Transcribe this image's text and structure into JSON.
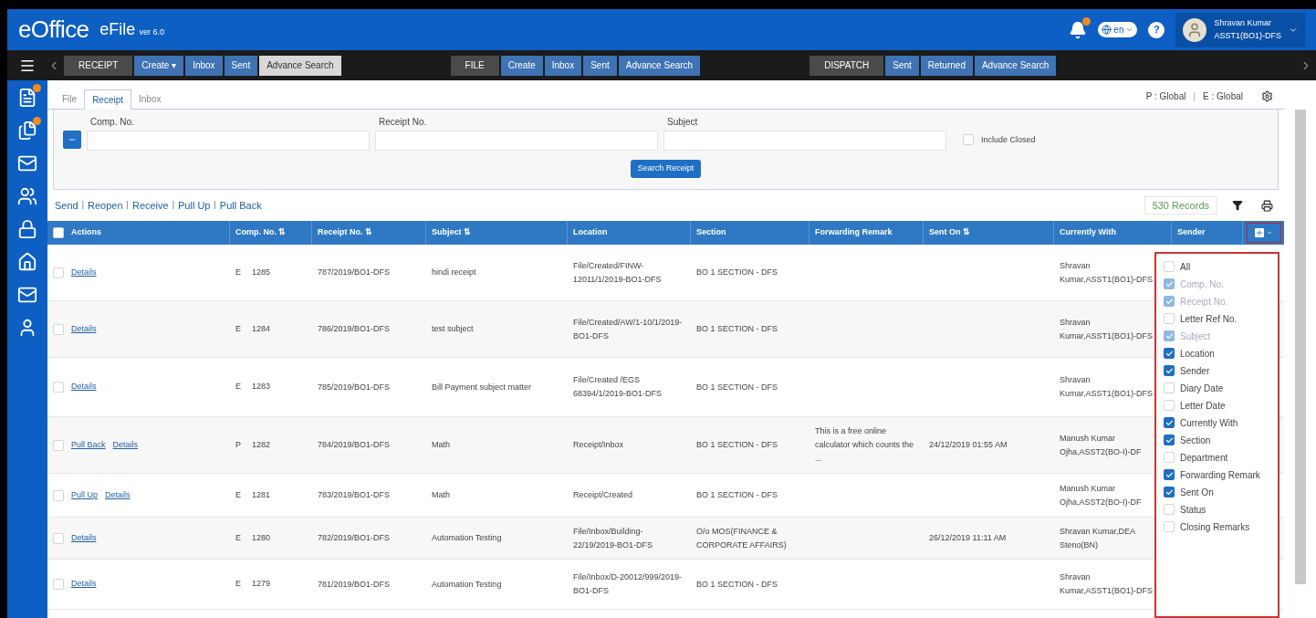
{
  "header": {
    "logo": "eOffice",
    "app": "eFile",
    "version": "ver 6.0",
    "language": "en",
    "help": "?",
    "user_name": "Shravan Kumar",
    "user_role": "ASST1(BO1)-DFS"
  },
  "nav": {
    "groups": [
      {
        "label": "RECEIPT",
        "items": [
          {
            "label": "Create ▾",
            "selected": false
          },
          {
            "label": "Inbox",
            "selected": false
          },
          {
            "label": "Sent",
            "selected": false
          },
          {
            "label": "Advance Search",
            "selected": true
          }
        ]
      },
      {
        "label": "FILE",
        "items": [
          {
            "label": "Create",
            "selected": false
          },
          {
            "label": "Inbox",
            "selected": false
          },
          {
            "label": "Sent",
            "selected": false
          },
          {
            "label": "Advance Search",
            "selected": false
          }
        ]
      },
      {
        "label": "DISPATCH",
        "items": [
          {
            "label": "Sent",
            "selected": false
          },
          {
            "label": "Returned",
            "selected": false
          },
          {
            "label": "Advance Search",
            "selected": false
          }
        ]
      }
    ]
  },
  "tabs": [
    {
      "label": "File",
      "selected": false
    },
    {
      "label": "Receipt",
      "selected": true
    },
    {
      "label": "Inbox",
      "selected": false
    }
  ],
  "scope": {
    "p": "P : Global",
    "separator": "|",
    "e": "E : Global"
  },
  "search": {
    "fields": [
      {
        "label": "Comp. No."
      },
      {
        "label": "Receipt No."
      },
      {
        "label": "Subject"
      }
    ],
    "include_closed": {
      "label": "Include Closed",
      "checked": false
    },
    "button": "Search Receipt"
  },
  "actions": [
    {
      "label": "Send"
    },
    {
      "separator": "|",
      "label": "Reopen"
    },
    {
      "separator": "|",
      "label": "Receive"
    },
    {
      "separator": "|",
      "label": "Pull Up"
    },
    {
      "separator": "|",
      "label": "Pull Back"
    }
  ],
  "records": "530 Records",
  "table": {
    "select_all_checked": false,
    "columns": [
      "Actions",
      "Comp. No. ⇅",
      "Receipt No. ⇅",
      "Subject ⇅",
      "Location",
      "Section",
      "Forwarding Remark",
      "Sent On ⇅",
      "Currently With",
      "Sender"
    ],
    "rows": [
      {
        "checked": false,
        "links": [
          "Details"
        ],
        "type": "E",
        "comp_no": "1285",
        "receipt_no": "787/2019/BO1-DFS",
        "subject": "hindi receipt",
        "location": "File/Created/FINW-12011/1/2019-BO1-DFS",
        "section": "BO 1 SECTION - DFS",
        "remark": "",
        "sent_on": "",
        "currently_with": "Shravan Kumar,ASST1(BO1)-DFS"
      },
      {
        "checked": false,
        "links": [
          "Details"
        ],
        "type": "E",
        "comp_no": "1284",
        "receipt_no": "786/2019/BO1-DFS",
        "subject": "test subject",
        "location": "File/Created/AW/1-10/1/2019-BO1-DFS",
        "section": "BO 1 SECTION - DFS",
        "remark": "",
        "sent_on": "",
        "currently_with": "Shravan Kumar,ASST1(BO1)-DFS"
      },
      {
        "checked": false,
        "links": [
          "Details"
        ],
        "type": "E",
        "comp_no": "1283",
        "receipt_no": "785/2019/BO1-DFS",
        "subject": "Bill Payment subject matter",
        "location": "File/Created /EGS 68394/1/2019-BO1-DFS",
        "section": "BO 1 SECTION - DFS",
        "remark": "",
        "sent_on": "",
        "currently_with": "Shravan Kumar,ASST1(BO1)-DFS"
      },
      {
        "checked": false,
        "links": [
          "Pull Back",
          "Details"
        ],
        "type": "P",
        "comp_no": "1282",
        "receipt_no": "784/2019/BO1-DFS",
        "subject": "Math",
        "location": "Receipt/Inbox",
        "section": "BO 1 SECTION - DFS",
        "remark": "This is a free online calculator which counts the ...",
        "sent_on": "24/12/2019 01:55 AM",
        "currently_with": "Manush Kumar Ojha,ASST2(BO-I)-DF"
      },
      {
        "checked": false,
        "links": [
          "Pull Up",
          "Details"
        ],
        "type": "E",
        "comp_no": "1281",
        "receipt_no": "783/2019/BO1-DFS",
        "subject": "Math",
        "location": "Receipt/Created",
        "section": "BO 1 SECTION - DFS",
        "remark": "",
        "sent_on": "",
        "currently_with": "Manush Kumar Ojha,ASST2(BO-I)-DF"
      },
      {
        "checked": false,
        "links": [
          "Details"
        ],
        "type": "E",
        "comp_no": "1280",
        "receipt_no": "782/2019/BO1-DFS",
        "subject": "Automation Testing",
        "location": "File/Inbox/Building-22/19/2019-BO1-DFS",
        "section": "O/o MOS(FINANCE & CORPORATE AFFAIRS)",
        "remark": "",
        "sent_on": "26/12/2019 11:11 AM",
        "currently_with": "Shravan Kumar,DEA Steno(BN)"
      },
      {
        "checked": false,
        "links": [
          "Details"
        ],
        "type": "E",
        "comp_no": "1279",
        "receipt_no": "781/2019/BO1-DFS",
        "subject": "Automation Testing",
        "location": "File/Inbox/D-20012/999/2019-BO1-DFS",
        "section": "BO 1 SECTION - DFS",
        "remark": "",
        "sent_on": "",
        "currently_with": "Shravan Kumar,ASST1(BO1)-DFS"
      }
    ]
  },
  "column_chooser": [
    {
      "label": "All",
      "checked": false,
      "disabled": false
    },
    {
      "label": "Comp. No.",
      "checked": true,
      "disabled": true
    },
    {
      "label": "Receipt No.",
      "checked": true,
      "disabled": true
    },
    {
      "label": "Letter Ref No.",
      "checked": false,
      "disabled": false
    },
    {
      "label": "Subject",
      "checked": true,
      "disabled": true
    },
    {
      "label": "Location",
      "checked": true,
      "disabled": false
    },
    {
      "label": "Sender",
      "checked": true,
      "disabled": false
    },
    {
      "label": "Diary Date",
      "checked": false,
      "disabled": false
    },
    {
      "label": "Letter Date",
      "checked": false,
      "disabled": false
    },
    {
      "label": "Currently With",
      "checked": true,
      "disabled": false
    },
    {
      "label": "Section",
      "checked": true,
      "disabled": false
    },
    {
      "label": "Department",
      "checked": false,
      "disabled": false
    },
    {
      "label": "Forwarding Remark",
      "checked": true,
      "disabled": false
    },
    {
      "label": "Sent On",
      "checked": true,
      "disabled": false
    },
    {
      "label": "Status",
      "checked": false,
      "disabled": false
    },
    {
      "label": "Closing Remarks",
      "checked": false,
      "disabled": false
    }
  ]
}
